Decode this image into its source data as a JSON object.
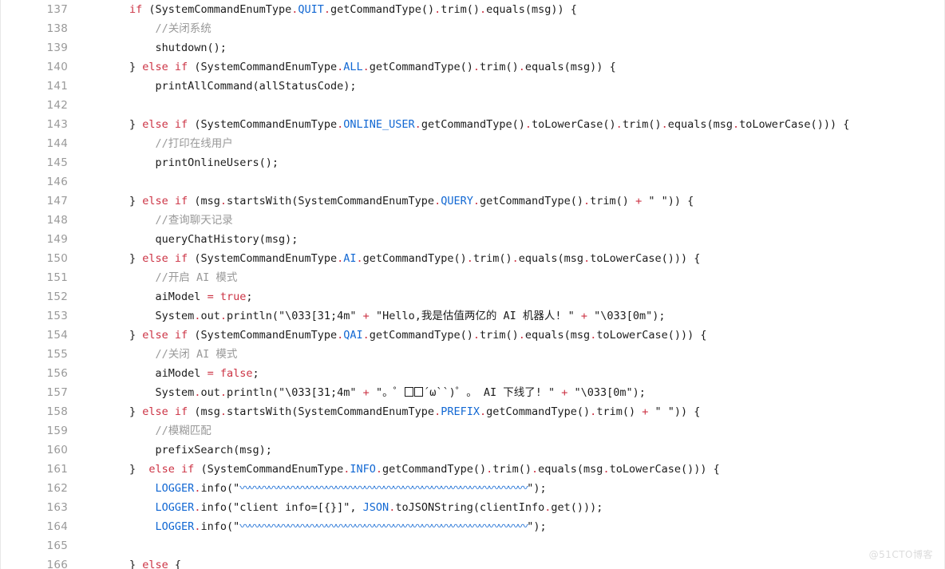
{
  "editor": {
    "language": "java",
    "first_line_number": 137,
    "last_line_number": 166,
    "colors": {
      "background": "#ffffff",
      "text": "#1c1c1c",
      "keyword": "#cc3344",
      "constant": "#1268d3",
      "comment": "#999999",
      "gutter": "#999999",
      "watermark": "#dcdcdc"
    },
    "watermark": "@51CTO博客"
  },
  "lines": [
    {
      "num": "137",
      "plain": "        if (SystemCommandEnumType.QUIT.getCommandType().trim().equals(msg)) {"
    },
    {
      "num": "138",
      "plain": "            //关闭系统"
    },
    {
      "num": "139",
      "plain": "            shutdown();"
    },
    {
      "num": "140",
      "plain": "        } else if (SystemCommandEnumType.ALL.getCommandType().trim().equals(msg)) {"
    },
    {
      "num": "141",
      "plain": "            printAllCommand(allStatusCode);"
    },
    {
      "num": "142",
      "plain": ""
    },
    {
      "num": "143",
      "plain": "        } else if (SystemCommandEnumType.ONLINE_USER.getCommandType().toLowerCase().trim().equals(msg.toLowerCase())) {"
    },
    {
      "num": "144",
      "plain": "            //打印在线用户"
    },
    {
      "num": "145",
      "plain": "            printOnlineUsers();"
    },
    {
      "num": "146",
      "plain": ""
    },
    {
      "num": "147",
      "plain": "        } else if (msg.startsWith(SystemCommandEnumType.QUERY.getCommandType().trim() + \" \")) {"
    },
    {
      "num": "148",
      "plain": "            //查询聊天记录"
    },
    {
      "num": "149",
      "plain": "            queryChatHistory(msg);"
    },
    {
      "num": "150",
      "plain": "        } else if (SystemCommandEnumType.AI.getCommandType().trim().equals(msg.toLowerCase())) {"
    },
    {
      "num": "151",
      "plain": "            //开启 AI 模式"
    },
    {
      "num": "152",
      "plain": "            aiModel = true;"
    },
    {
      "num": "153",
      "plain": "            System.out.println(\"\\033[31;4m\" + \"Hello,我是估值两亿的 AI 机器人! \" + \"\\033[0m\");"
    },
    {
      "num": "154",
      "plain": "        } else if (SystemCommandEnumType.QAI.getCommandType().trim().equals(msg.toLowerCase())) {"
    },
    {
      "num": "155",
      "plain": "            //关闭 AI 模式"
    },
    {
      "num": "156",
      "plain": "            aiModel = false;"
    },
    {
      "num": "157",
      "plain": "            System.out.println(\"\\033[31;4m\" + \"。゜□□´ω``)゜。 AI 下线了! \" + \"\\033[0m\");"
    },
    {
      "num": "158",
      "plain": "        } else if (msg.startsWith(SystemCommandEnumType.PREFIX.getCommandType().trim() + \" \")) {"
    },
    {
      "num": "159",
      "plain": "            //模糊匹配"
    },
    {
      "num": "160",
      "plain": "            prefixSearch(msg);"
    },
    {
      "num": "161",
      "plain": "        }  else if (SystemCommandEnumType.INFO.getCommandType().trim().equals(msg.toLowerCase())) {"
    },
    {
      "num": "162",
      "plain": "            LOGGER.info(\"〰〰〰〰〰〰〰〰〰〰〰〰〰〰〰〰〰〰〰〰〰〰〰〰〰〰〰〰〰〰\");"
    },
    {
      "num": "163",
      "plain": "            LOGGER.info(\"client info=[{}]\", JSON.toJSONString(clientInfo.get()));"
    },
    {
      "num": "164",
      "plain": "            LOGGER.info(\"〰〰〰〰〰〰〰〰〰〰〰〰〰〰〰〰〰〰〰〰〰〰〰〰〰〰〰〰〰〰\");"
    },
    {
      "num": "165",
      "plain": ""
    },
    {
      "num": "166",
      "plain": "        } else {"
    }
  ]
}
